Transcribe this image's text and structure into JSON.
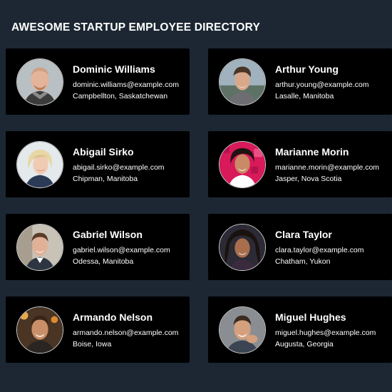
{
  "page": {
    "title": "AWESOME STARTUP EMPLOYEE DIRECTORY"
  },
  "employees": [
    {
      "name": "Dominic Williams",
      "email": "dominic.williams@example.com",
      "location": "Campbellton, Saskatchewan"
    },
    {
      "name": "Arthur Young",
      "email": "arthur.young@example.com",
      "location": "Lasalle, Manitoba"
    },
    {
      "name": "Abigail Sirko",
      "email": "abigail.sirko@example.com",
      "location": "Chipman, Manitoba"
    },
    {
      "name": "Marianne Morin",
      "email": "marianne.morin@example.com",
      "location": "Jasper, Nova Scotia"
    },
    {
      "name": "Gabriel Wilson",
      "email": "gabriel.wilson@example.com",
      "location": "Odessa, Manitoba"
    },
    {
      "name": "Clara Taylor",
      "email": "clara.taylor@example.com",
      "location": "Chatham, Yukon"
    },
    {
      "name": "Armando Nelson",
      "email": "armando.nelson@example.com",
      "location": "Boise, Iowa"
    },
    {
      "name": "Miguel Hughes",
      "email": "miguel.hughes@example.com",
      "location": "Augusta, Georgia"
    }
  ],
  "colors": {
    "background": "#1c2733",
    "card": "#000000",
    "text": "#ffffff"
  }
}
